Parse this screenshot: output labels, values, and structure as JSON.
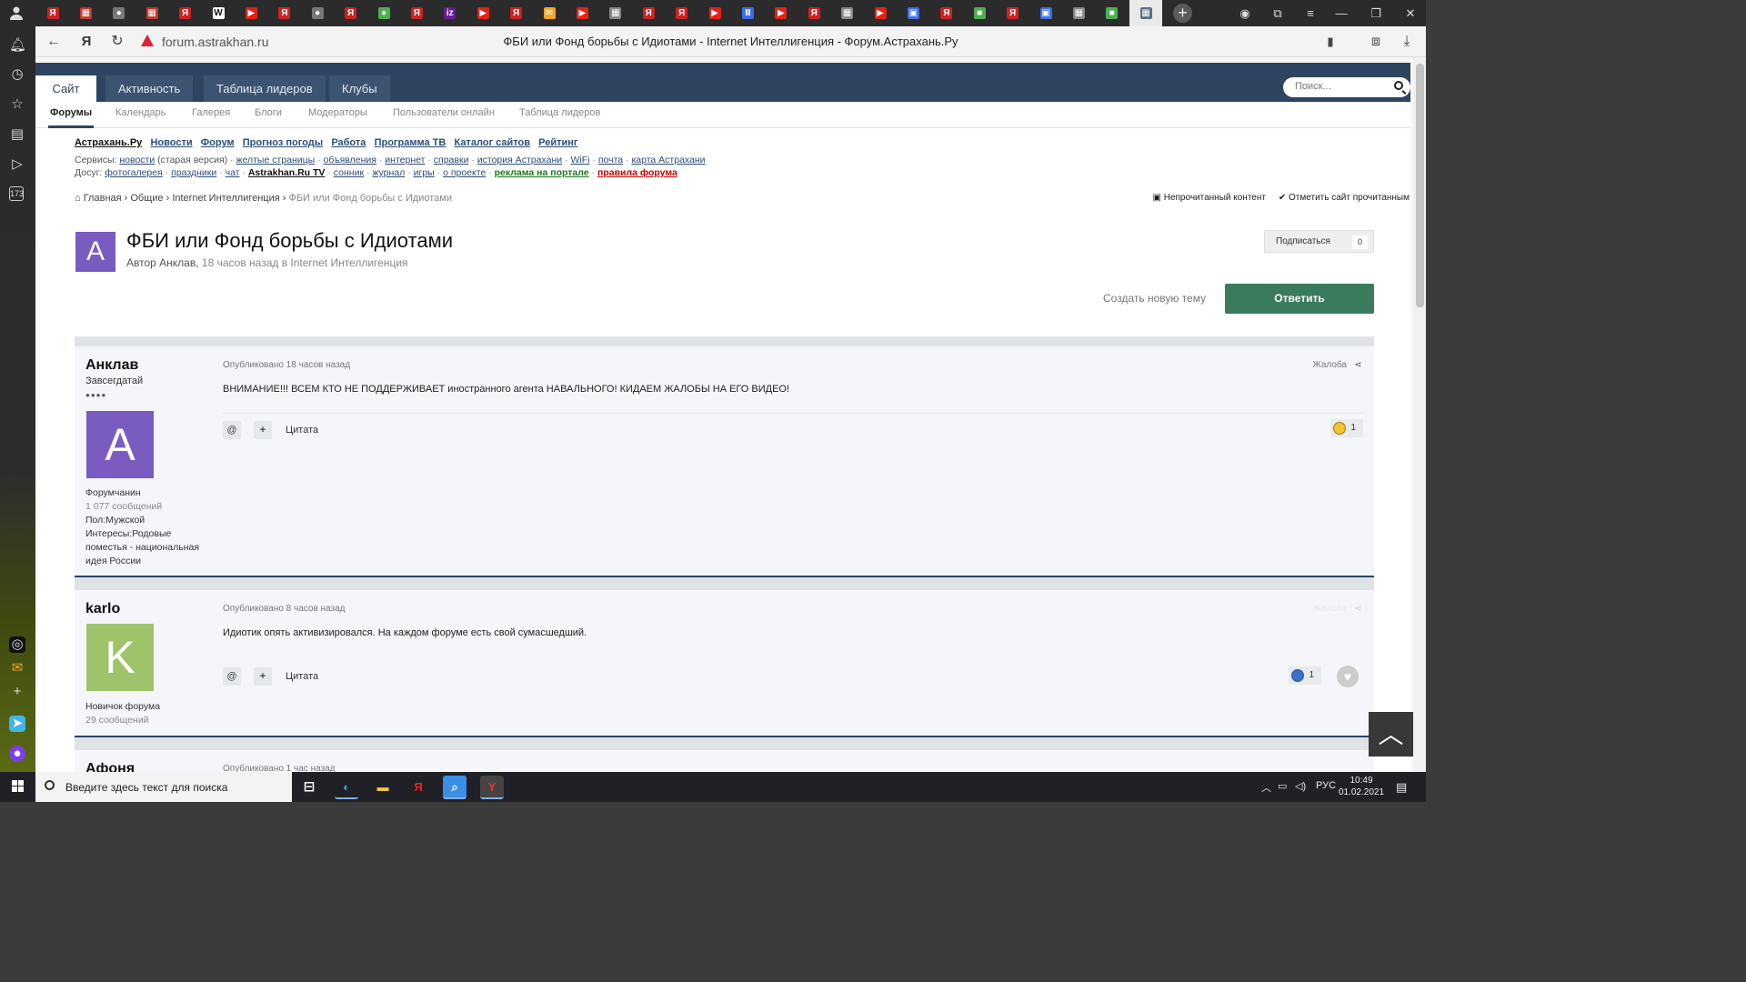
{
  "browser": {
    "url": "forum.astrakhan.ru",
    "page_title": "ФБИ или Фонд борьбы с Идиотами - Internet Интеллигенция - Форум.Астрахань.Ру",
    "tab_favicons": [
      {
        "color": "#cc2222",
        "glyph": "Я"
      },
      {
        "color": "#c0392b",
        "glyph": "▦"
      },
      {
        "color": "#777777",
        "glyph": "●"
      },
      {
        "color": "#c0392b",
        "glyph": "▦"
      },
      {
        "color": "#cc2222",
        "glyph": "Я"
      },
      {
        "color": "#ffffff",
        "glyph": "W"
      },
      {
        "color": "#e62117",
        "glyph": "▶"
      },
      {
        "color": "#cc2222",
        "glyph": "Я"
      },
      {
        "color": "#777777",
        "glyph": "●"
      },
      {
        "color": "#cc2222",
        "glyph": "Я"
      },
      {
        "color": "#4caf50",
        "glyph": "●"
      },
      {
        "color": "#cc2222",
        "glyph": "Я"
      },
      {
        "color": "#6a1b9a",
        "glyph": "iz"
      },
      {
        "color": "#e62117",
        "glyph": "▶"
      },
      {
        "color": "#cc2222",
        "glyph": "Я"
      },
      {
        "color": "#f5a623",
        "glyph": "✉"
      },
      {
        "color": "#e62117",
        "glyph": "▶"
      },
      {
        "color": "#888888",
        "glyph": "▦"
      },
      {
        "color": "#cc2222",
        "glyph": "Я"
      },
      {
        "color": "#cc2222",
        "glyph": "Я"
      },
      {
        "color": "#e62117",
        "glyph": "▶"
      },
      {
        "color": "#3b6fe8",
        "glyph": "Ⅱ"
      },
      {
        "color": "#e62117",
        "glyph": "▶"
      },
      {
        "color": "#cc2222",
        "glyph": "Я"
      },
      {
        "color": "#888888",
        "glyph": "▦"
      },
      {
        "color": "#e62117",
        "glyph": "▶"
      },
      {
        "color": "#3b6fe8",
        "glyph": "▣"
      },
      {
        "color": "#cc2222",
        "glyph": "Я"
      },
      {
        "color": "#4caf50",
        "glyph": "■"
      },
      {
        "color": "#cc2222",
        "glyph": "Я"
      },
      {
        "color": "#3b6fe8",
        "glyph": "▣"
      },
      {
        "color": "#888888",
        "glyph": "▦"
      },
      {
        "color": "#4caf50",
        "glyph": "■"
      }
    ],
    "sidebar_badge": "173"
  },
  "forum": {
    "top_tabs": [
      "Сайт",
      "Активность",
      "Таблица лидеров",
      "Клубы"
    ],
    "search_placeholder": "Поиск...",
    "sub_tabs": [
      "Форумы",
      "Календарь",
      "Галерея",
      "Блоги",
      "Модераторы",
      "Пользователи онлайн",
      "Таблица лидеров"
    ],
    "portal_links": [
      "Астрахань.Ру",
      "Новости",
      "Форум",
      "Прогноз погоды",
      "Работа",
      "Программа ТВ",
      "Каталог сайтов",
      "Рейтинг"
    ],
    "services_label": "Сервисы:",
    "services": {
      "news": "новости",
      "news_note": "(старая версия)",
      "items": [
        "желтые страницы",
        "объявления",
        "интернет",
        "справки",
        "история Астрахани",
        "WiFi",
        "почта",
        "карта Астрахани"
      ]
    },
    "leisure_label": "Досуг:",
    "leisure": [
      "фотогалерея",
      "праздники",
      "чат",
      "Astrakhan.Ru TV",
      "сонник",
      "журнал",
      "игры",
      "о проекте"
    ],
    "leisure_green": "реклама на портале",
    "leisure_red": "правила форума",
    "breadcrumb": [
      "Главная",
      "Общие",
      "Internet Интеллигенция",
      "ФБИ или Фонд борьбы с Идиотами"
    ],
    "unread_content": "Непрочитанный контент",
    "mark_read": "Отметить сайт прочитанным",
    "topic": {
      "avatar_letter": "A",
      "title": "ФБИ или Фонд борьбы с Идиотами",
      "author_prefix": "Автор Анклав,",
      "meta_rest": "18 часов назад в Internet Интеллигенция"
    },
    "subscribe_label": "Подписаться",
    "subscribe_count": "0",
    "new_topic": "Создать новую тему",
    "reply": "Ответить",
    "quote_label": "Цитата",
    "report_label": "Жалоба",
    "posts": [
      {
        "author": "Анклав",
        "title": "Завсегдатай",
        "pips": "●●●●",
        "avatar_letter": "A",
        "avatar_color": "#7a5cc0",
        "group": "Форумчанин",
        "count": "1 077 сообщений",
        "gender": "Пол:Мужской",
        "interests": [
          "Интересы:Родовые",
          "поместья - национальная",
          "идея России"
        ],
        "date": "Опубликовано 18 часов назад",
        "text": "ВНИМАНИЕ!!! ВСЕМ КТО НЕ ПОДДЕРЖИВАЕТ иностранного агента НАВАЛЬНОГО! КИДАЕМ ЖАЛОБЫ НА ЕГО ВИДЕО!",
        "reaction_count": "1"
      },
      {
        "author": "karlo",
        "avatar_letter": "K",
        "avatar_color": "#9ec36b",
        "group": "Новичок форума",
        "count": "29 сообщений",
        "date": "Опубликовано 8 часов назад",
        "text": "Идиотик опять активизировался. На каждом форуме есть свой сумасшедший.",
        "reaction_count": "1"
      },
      {
        "author": "Афоня",
        "date": "Опубликовано 1 час назад"
      }
    ]
  },
  "taskbar": {
    "search_text": "Введите здесь текст для поиска",
    "lang": "РУС",
    "time": "10:49",
    "date": "01.02.2021"
  }
}
